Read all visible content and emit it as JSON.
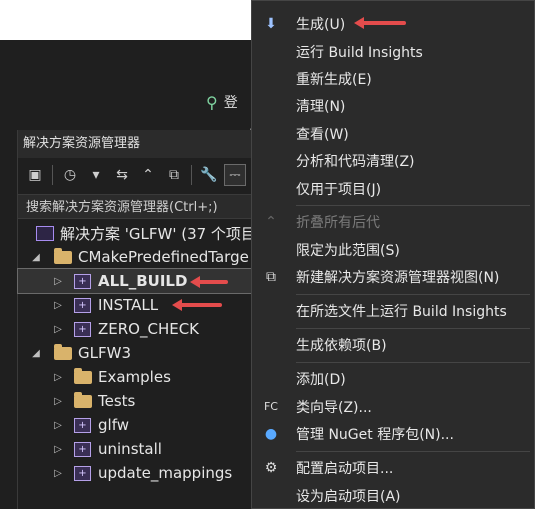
{
  "titlebar": {
    "login_partial": "登",
    "person_icon": "person-add-icon"
  },
  "solution_explorer": {
    "title": "解决方案资源管理器",
    "search_placeholder": "搜索解决方案资源管理器(Ctrl+;)",
    "tree": [
      {
        "label": "解决方案 'GLFW' (37 个项目",
        "kind": "solution"
      },
      {
        "label": "CMakePredefinedTarge",
        "kind": "folder",
        "expanded": true
      },
      {
        "label": "ALL_BUILD",
        "kind": "project",
        "selected": true
      },
      {
        "label": "INSTALL",
        "kind": "project"
      },
      {
        "label": "ZERO_CHECK",
        "kind": "project"
      },
      {
        "label": "GLFW3",
        "kind": "folder",
        "expanded": true
      },
      {
        "label": "Examples",
        "kind": "folder"
      },
      {
        "label": "Tests",
        "kind": "folder"
      },
      {
        "label": "glfw",
        "kind": "project"
      },
      {
        "label": "uninstall",
        "kind": "project"
      },
      {
        "label": "update_mappings",
        "kind": "project"
      }
    ]
  },
  "context_menu": {
    "items": [
      {
        "label": "生成(U)",
        "icon": "build-icon"
      },
      {
        "label": "运行 Build Insights"
      },
      {
        "label": "重新生成(E)"
      },
      {
        "label": "清理(N)"
      },
      {
        "label": "查看(W)"
      },
      {
        "label": "分析和代码清理(Z)"
      },
      {
        "label": "仅用于项目(J)"
      },
      {
        "label": "折叠所有后代",
        "disabled": true,
        "icon": "collapse-icon"
      },
      {
        "label": "限定为此范围(S)"
      },
      {
        "label": "新建解决方案资源管理器视图(N)",
        "icon": "new-view-icon"
      },
      {
        "label": "在所选文件上运行 Build Insights"
      },
      {
        "label": "生成依赖项(B)"
      },
      {
        "label": "添加(D)"
      },
      {
        "label": "类向导(Z)...",
        "icon": "class-wizard-icon"
      },
      {
        "label": "管理 NuGet 程序包(N)...",
        "icon": "nuget-icon"
      },
      {
        "label": "配置启动项目...",
        "icon": "gear-icon"
      },
      {
        "label": "设为启动项目(A)"
      }
    ]
  },
  "colors": {
    "annotation_arrow": "#e44c4c",
    "menu_bg": "#2b2b2b"
  }
}
